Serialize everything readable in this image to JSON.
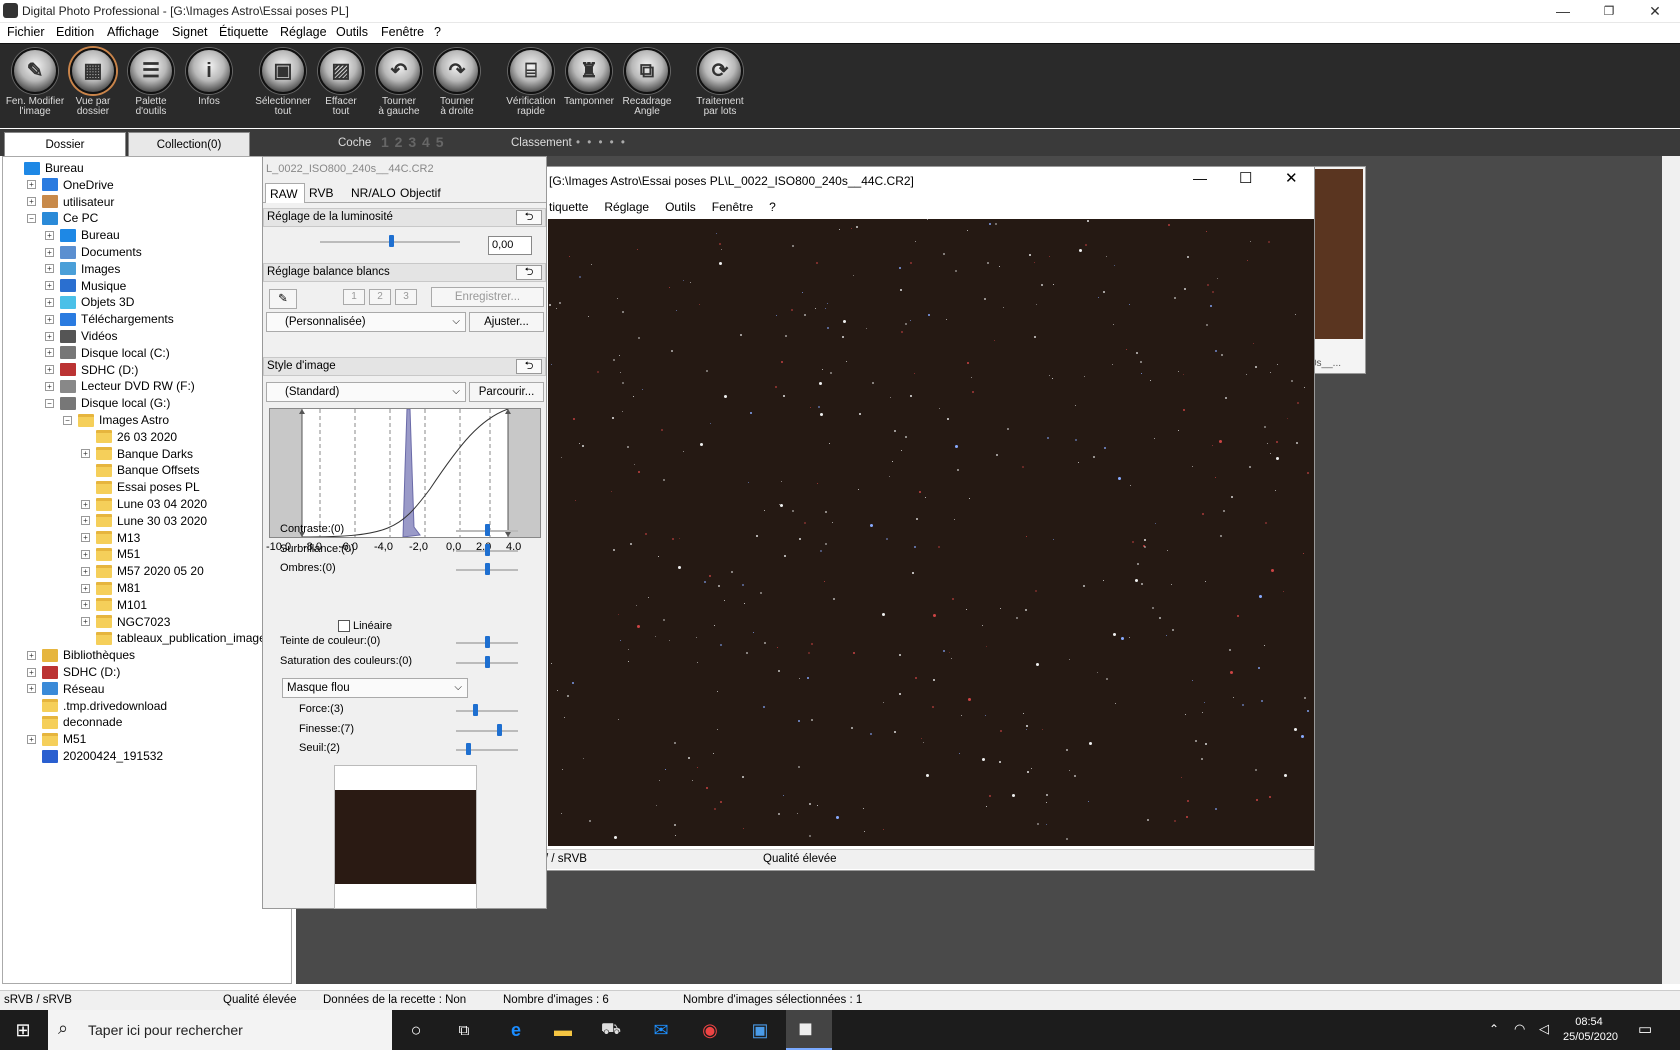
{
  "window": {
    "title": "Digital Photo Professional - [G:\\Images Astro\\Essai poses PL]",
    "min": "—",
    "max": "❐",
    "close": "✕"
  },
  "menu": [
    "Fichier",
    "Edition",
    "Affichage",
    "Signet",
    "Étiquette",
    "Réglage",
    "Outils",
    "Fenêtre",
    "?"
  ],
  "toolbar": [
    {
      "l1": "Fen. Modifier",
      "l2": "l'image",
      "icon": "edit-image-icon",
      "g": "✎"
    },
    {
      "l1": "Vue par",
      "l2": "dossier",
      "icon": "folder-view-icon",
      "g": "▦"
    },
    {
      "l1": "Palette",
      "l2": "d'outils",
      "icon": "tool-palette-icon",
      "g": "☰"
    },
    {
      "l1": "Infos",
      "l2": "",
      "icon": "info-icon",
      "g": "i"
    },
    {
      "l1": "Sélectionner",
      "l2": "tout",
      "icon": "select-all-icon",
      "g": "▣"
    },
    {
      "l1": "Effacer",
      "l2": "tout",
      "icon": "clear-all-icon",
      "g": "▨"
    },
    {
      "l1": "Tourner",
      "l2": "à gauche",
      "icon": "rotate-left-icon",
      "g": "↶"
    },
    {
      "l1": "Tourner",
      "l2": "à droite",
      "icon": "rotate-right-icon",
      "g": "↷"
    },
    {
      "l1": "Vérification",
      "l2": "rapide",
      "icon": "quick-check-icon",
      "g": "⌸"
    },
    {
      "l1": "Tamponner",
      "l2": "",
      "icon": "stamp-icon",
      "g": "♜"
    },
    {
      "l1": "Recadrage",
      "l2": "Angle",
      "icon": "crop-angle-icon",
      "g": "⧉"
    },
    {
      "l1": "Traitement",
      "l2": "par lots",
      "icon": "batch-process-icon",
      "g": "⟳"
    }
  ],
  "tabs": {
    "dossier": "Dossier",
    "collection": "Collection(0)",
    "coche": "Coche",
    "coche_nums": "1 2 3 4 5",
    "classement": "Classement",
    "stars": "• • • • •"
  },
  "tree": [
    {
      "label": "Bureau",
      "lvl": 0,
      "ex": "",
      "icon": "desktop"
    },
    {
      "label": "OneDrive",
      "lvl": 1,
      "ex": "+",
      "icon": "cloud"
    },
    {
      "label": "utilisateur",
      "lvl": 1,
      "ex": "+",
      "icon": "user"
    },
    {
      "label": "Ce PC",
      "lvl": 1,
      "ex": "−",
      "icon": "pc"
    },
    {
      "label": "Bureau",
      "lvl": 2,
      "ex": "+",
      "icon": "desktop"
    },
    {
      "label": "Documents",
      "lvl": 2,
      "ex": "+",
      "icon": "docs"
    },
    {
      "label": "Images",
      "lvl": 2,
      "ex": "+",
      "icon": "pics"
    },
    {
      "label": "Musique",
      "lvl": 2,
      "ex": "+",
      "icon": "music"
    },
    {
      "label": "Objets 3D",
      "lvl": 2,
      "ex": "+",
      "icon": "obj3d"
    },
    {
      "label": "Téléchargements",
      "lvl": 2,
      "ex": "+",
      "icon": "download"
    },
    {
      "label": "Vidéos",
      "lvl": 2,
      "ex": "+",
      "icon": "video"
    },
    {
      "label": "Disque local (C:)",
      "lvl": 2,
      "ex": "+",
      "icon": "drive"
    },
    {
      "label": "SDHC (D:)",
      "lvl": 2,
      "ex": "+",
      "icon": "sd"
    },
    {
      "label": "Lecteur DVD RW (F:)",
      "lvl": 2,
      "ex": "+",
      "icon": "dvd"
    },
    {
      "label": "Disque local (G:)",
      "lvl": 2,
      "ex": "−",
      "icon": "drive"
    },
    {
      "label": "Images Astro",
      "lvl": 3,
      "ex": "−",
      "icon": "folder"
    },
    {
      "label": "26 03 2020",
      "lvl": 4,
      "ex": "",
      "icon": "folder"
    },
    {
      "label": "Banque Darks",
      "lvl": 4,
      "ex": "+",
      "icon": "folder"
    },
    {
      "label": "Banque Offsets",
      "lvl": 4,
      "ex": "",
      "icon": "folder"
    },
    {
      "label": "Essai poses PL",
      "lvl": 4,
      "ex": "",
      "icon": "folder"
    },
    {
      "label": "Lune 03 04 2020",
      "lvl": 4,
      "ex": "+",
      "icon": "folder"
    },
    {
      "label": "Lune 30 03 2020",
      "lvl": 4,
      "ex": "+",
      "icon": "folder"
    },
    {
      "label": "M13",
      "lvl": 4,
      "ex": "+",
      "icon": "folder"
    },
    {
      "label": "M51",
      "lvl": 4,
      "ex": "+",
      "icon": "folder"
    },
    {
      "label": "M57 2020 05 20",
      "lvl": 4,
      "ex": "+",
      "icon": "folder"
    },
    {
      "label": "M81",
      "lvl": 4,
      "ex": "+",
      "icon": "folder"
    },
    {
      "label": "M101",
      "lvl": 4,
      "ex": "+",
      "icon": "folder"
    },
    {
      "label": "NGC7023",
      "lvl": 4,
      "ex": "+",
      "icon": "folder"
    },
    {
      "label": "tableaux_publication_image",
      "lvl": 4,
      "ex": "",
      "icon": "folder"
    },
    {
      "label": "Bibliothèques",
      "lvl": 1,
      "ex": "+",
      "icon": "library"
    },
    {
      "label": "SDHC (D:)",
      "lvl": 1,
      "ex": "+",
      "icon": "sd"
    },
    {
      "label": "Réseau",
      "lvl": 1,
      "ex": "+",
      "icon": "network"
    },
    {
      "label": ".tmp.drivedownload",
      "lvl": 1,
      "ex": "",
      "icon": "folder"
    },
    {
      "label": "deconnade",
      "lvl": 1,
      "ex": "",
      "icon": "folder"
    },
    {
      "label": "M51",
      "lvl": 1,
      "ex": "+",
      "icon": "folder"
    },
    {
      "label": "20200424_191532",
      "lvl": 1,
      "ex": "",
      "icon": "zip"
    }
  ],
  "palette": {
    "title": "L_0022_ISO800_240s__44C.CR2",
    "tabs": [
      "RAW",
      "RVB",
      "NR/ALO",
      "Objectif"
    ],
    "brightness_hdr": "Réglage de la luminosité",
    "brightness_val": "0,00",
    "wb_hdr": "Réglage balance blancs",
    "wb_btns": [
      "1",
      "2",
      "3"
    ],
    "wb_save": "Enregistrer...",
    "wb_mode": "(Personnalisée)",
    "wb_adjust": "Ajuster...",
    "style_hdr": "Style d'image",
    "style_mode": "(Standard)",
    "style_browse": "Parcourir...",
    "axis": [
      "-10,0",
      "-8,0",
      "-6,0",
      "-4,0",
      "-2,0",
      "0,0",
      "2,0",
      "4,0"
    ],
    "sliders": [
      {
        "label": "Contraste:(0)",
        "v": 0.5
      },
      {
        "label": "Surbrillance:(0)",
        "v": 0.5
      },
      {
        "label": "Ombres:(0)",
        "v": 0.5
      }
    ],
    "lineaire": "Linéaire",
    "sliders2": [
      {
        "label": "Teinte de couleur:(0)",
        "v": 0.5
      },
      {
        "label": "Saturation des couleurs:(0)",
        "v": 0.5
      }
    ],
    "sharp_mode": "Masque flou",
    "sliders3": [
      {
        "label": "Force:(3)",
        "v": 0.3
      },
      {
        "label": "Finesse:(7)",
        "v": 0.7
      },
      {
        "label": "Seuil:(2)",
        "v": 0.2
      }
    ]
  },
  "imagewin": {
    "title": "[G:\\Images Astro\\Essai poses PL\\L_0022_ISO800_240s__44C.CR2]",
    "menu": [
      "tiquette",
      "Réglage",
      "Outils",
      "Fenêtre",
      "?"
    ],
    "status_left": "/ / sRVB",
    "status_quality": "Qualité élevée",
    "min": "—",
    "max": "☐",
    "close": "✕"
  },
  "thumbnail": {
    "caption": "0s__..."
  },
  "statusbar": [
    "sRVB / sRVB",
    "Qualité élevée",
    "Données de la recette : Non",
    "Nombre d'images : 6",
    "Nombre d'images sélectionnées : 1"
  ],
  "taskbar": {
    "search": "Taper ici pour rechercher",
    "time": "08:54",
    "date": "25/05/2020"
  },
  "colors": {
    "toolbar": "#2a2a2a",
    "sky": "#251913",
    "accent": "#1e6fd0"
  }
}
